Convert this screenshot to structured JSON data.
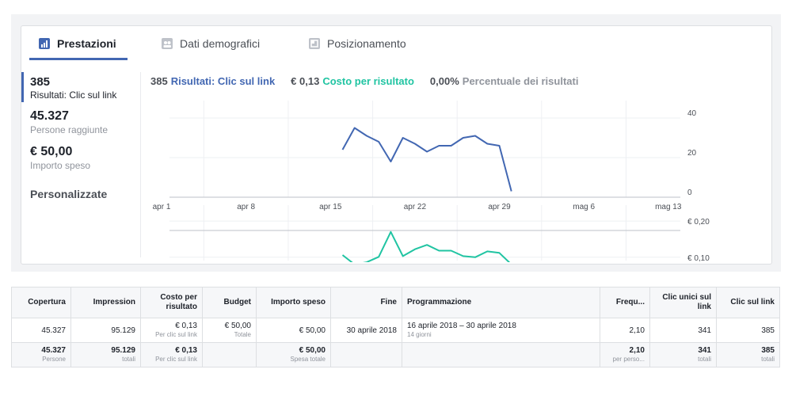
{
  "tabs": [
    {
      "label": "Prestazioni",
      "icon": "bar-chart-icon"
    },
    {
      "label": "Dati demografici",
      "icon": "people-icon"
    },
    {
      "label": "Posizionamento",
      "icon": "placement-icon"
    }
  ],
  "sidebar": {
    "metrics": [
      {
        "value": "385",
        "label": "Risultati: Clic sul link"
      },
      {
        "value": "45.327",
        "label": "Persone raggiunte"
      },
      {
        "value": "€ 50,00",
        "label": "Importo speso"
      }
    ],
    "custom_label": "Personalizzate"
  },
  "legend": {
    "results_value": "385",
    "results_label": "Risultati: Clic sul link",
    "cost_value": "€ 0,13",
    "cost_label": "Costo per risultato",
    "pct_value": "0,00%",
    "pct_label": "Percentuale dei risultati"
  },
  "colors": {
    "blue": "#4267b2",
    "green": "#20c4a2",
    "gray": "#90949c"
  },
  "chart_data": [
    {
      "type": "line",
      "title": "",
      "series": [
        {
          "name": "Risultati: Clic sul link",
          "color": "#4267b2",
          "x": [
            "apr 16",
            "apr 17",
            "apr 18",
            "apr 19",
            "apr 20",
            "apr 21",
            "apr 22",
            "apr 23",
            "apr 24",
            "apr 25",
            "apr 26",
            "apr 27",
            "apr 28",
            "apr 29",
            "apr 30"
          ],
          "values": [
            24,
            35,
            31,
            28,
            18,
            30,
            27,
            23,
            26,
            26,
            30,
            31,
            27,
            26,
            3
          ]
        }
      ],
      "x_ticks": [
        "apr 1",
        "apr 8",
        "apr 15",
        "apr 22",
        "apr 29",
        "mag 6",
        "mag 13"
      ],
      "y_ticks": [
        "40",
        "20",
        "0"
      ],
      "ylim": [
        0,
        40
      ]
    },
    {
      "type": "line",
      "series": [
        {
          "name": "Costo per risultato",
          "color": "#20c4a2",
          "x": [
            "apr 16",
            "apr 17",
            "apr 18",
            "apr 19",
            "apr 20",
            "apr 21",
            "apr 22",
            "apr 23",
            "apr 24",
            "apr 25",
            "apr 26",
            "apr 27",
            "apr 28",
            "apr 29",
            "apr 30"
          ],
          "values": [
            0.106,
            0.08,
            0.086,
            0.101,
            0.17,
            0.103,
            0.122,
            0.134,
            0.118,
            0.118,
            0.103,
            0.1,
            0.116,
            0.112,
            0.08
          ]
        }
      ],
      "y_ticks": [
        "€ 0,20",
        "€ 0,10"
      ],
      "ylim": [
        0.06,
        0.22
      ]
    }
  ],
  "table": {
    "headers": [
      "Copertura",
      "Impression",
      "Costo per risultato",
      "Budget",
      "Importo speso",
      "Fine",
      "Programmazione",
      "Frequ...",
      "Clic unici sul link",
      "Clic sul link"
    ],
    "row": [
      {
        "v": "45.327",
        "s": ""
      },
      {
        "v": "95.129",
        "s": ""
      },
      {
        "v": "€ 0,13",
        "s": "Per clic sul link"
      },
      {
        "v": "€ 50,00",
        "s": "Totale"
      },
      {
        "v": "€ 50,00",
        "s": ""
      },
      {
        "v": "30 aprile 2018",
        "s": ""
      },
      {
        "v": "16 aprile 2018 – 30 aprile 2018",
        "s": "14 giorni"
      },
      {
        "v": "2,10",
        "s": ""
      },
      {
        "v": "341",
        "s": ""
      },
      {
        "v": "385",
        "s": ""
      }
    ],
    "total": [
      {
        "v": "45.327",
        "s": "Persone"
      },
      {
        "v": "95.129",
        "s": "totali"
      },
      {
        "v": "€ 0,13",
        "s": "Per clic sul link"
      },
      {
        "v": "",
        "s": ""
      },
      {
        "v": "€ 50,00",
        "s": "Spesa totale"
      },
      {
        "v": "",
        "s": ""
      },
      {
        "v": "",
        "s": ""
      },
      {
        "v": "2,10",
        "s": "per perso..."
      },
      {
        "v": "341",
        "s": "totali"
      },
      {
        "v": "385",
        "s": "totali"
      }
    ]
  }
}
